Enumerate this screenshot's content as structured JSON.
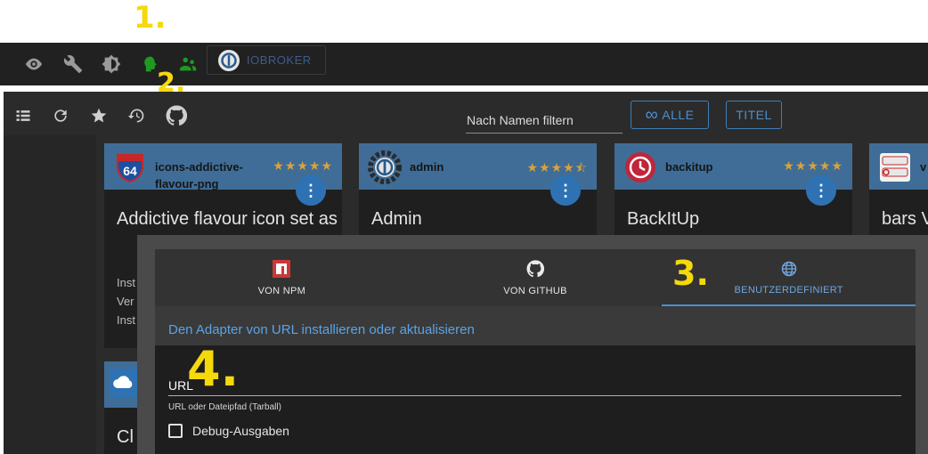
{
  "annotations": {
    "n1": "1.",
    "n2": "2.",
    "n3": "3.",
    "n4": "4."
  },
  "toolbar": {
    "icons": [
      "eye-icon",
      "wrench-icon",
      "brightness-icon",
      "head-icon",
      "people-icon"
    ],
    "iobroker_label": "IOBROKER"
  },
  "adapters_toolbar": {
    "icons": [
      "list-icon",
      "refresh-icon",
      "star-icon",
      "update-icon",
      "github-icon"
    ],
    "filter_placeholder": "Nach Namen filtern",
    "all_label": "ALLE",
    "title_label": "TITEL"
  },
  "cards": [
    {
      "name": "icons-addictive-flavour-png",
      "title": "Addictive flavour icon set as",
      "rating": "★★★★★",
      "lines": [
        "Inst",
        "Ver",
        "Inst"
      ]
    },
    {
      "name": "admin",
      "title": "Admin",
      "rating": "★★★★⯪"
    },
    {
      "name": "backitup",
      "title": "BackItUp",
      "rating": "★★★★★"
    },
    {
      "name": "v",
      "title": "bars V"
    }
  ],
  "card_partial": {
    "title": "Cl"
  },
  "dialog": {
    "tabs": [
      {
        "label": "VON NPM",
        "icon": "npm-icon"
      },
      {
        "label": "VON GITHUB",
        "icon": "github-icon"
      },
      {
        "label": "BENUTZERDEFINIERT",
        "icon": "globe-icon",
        "active": true
      }
    ],
    "heading": "Den Adapter von URL installieren oder aktualisieren",
    "url_label": "URL",
    "url_help": "URL oder Dateipfad (Tarball)",
    "debug_label": "Debug-Ausgaben",
    "debug_checked": false
  },
  "colors": {
    "accent": "#4b8fcf",
    "card_header": "#3f6d97",
    "annotation": "#f5d90a",
    "star": "#d9a23a"
  }
}
